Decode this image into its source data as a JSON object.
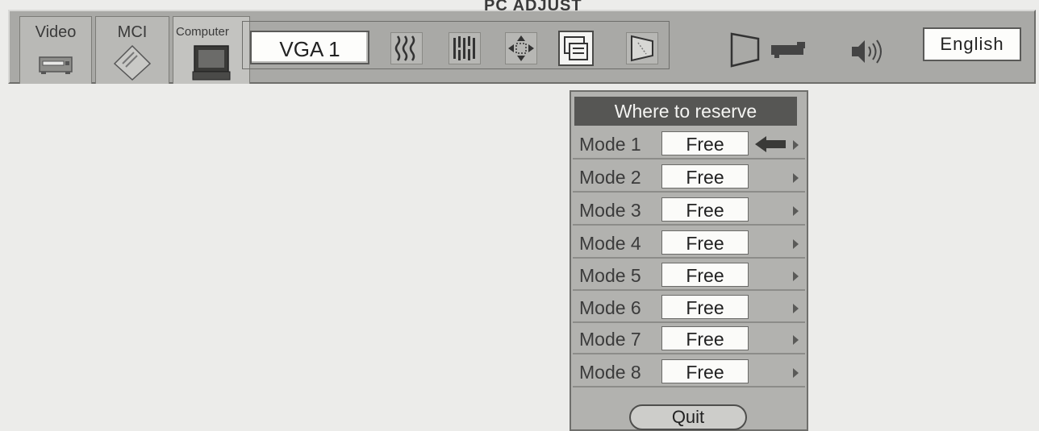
{
  "menubar": {
    "tabs": [
      {
        "label": "Video",
        "icon": "vcr-icon"
      },
      {
        "label": "MCI",
        "icon": "card-icon"
      },
      {
        "label": "Computer",
        "icon": "monitor-icon"
      }
    ],
    "section_title": "PC ADJUST",
    "source_value": "VGA 1",
    "adjust_icons": [
      "fine-sync-icon",
      "total-dots-icon",
      "position-icon",
      "memory-icon",
      "reset-icon"
    ],
    "right_icons": [
      "screen-icon",
      "projector-icon",
      "speaker-icon"
    ],
    "language": "English"
  },
  "dialog": {
    "title": "Where to reserve",
    "modes": [
      {
        "label": "Mode 1",
        "value": "Free"
      },
      {
        "label": "Mode 2",
        "value": "Free"
      },
      {
        "label": "Mode 3",
        "value": "Free"
      },
      {
        "label": "Mode 4",
        "value": "Free"
      },
      {
        "label": "Mode 5",
        "value": "Free"
      },
      {
        "label": "Mode 6",
        "value": "Free"
      },
      {
        "label": "Mode 7",
        "value": "Free"
      },
      {
        "label": "Mode 8",
        "value": "Free"
      }
    ],
    "selected_index": 0,
    "quit_label": "Quit"
  }
}
